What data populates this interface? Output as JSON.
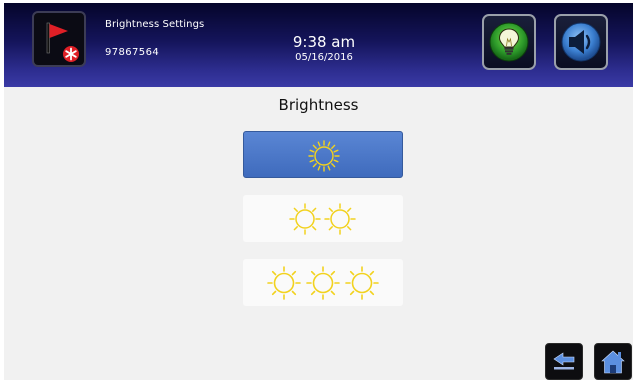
{
  "header": {
    "screen_title": "Brightness Settings",
    "device_id": "97867564",
    "time": "9:38 am",
    "date": "05/16/2016",
    "alarm_icon": "red-flag-alarm-icon",
    "light_icon": "lightbulb-icon",
    "sound_icon": "speaker-icon"
  },
  "main": {
    "title": "Brightness",
    "levels": [
      {
        "suns": 1,
        "selected": true
      },
      {
        "suns": 2,
        "selected": false
      },
      {
        "suns": 3,
        "selected": false
      }
    ]
  },
  "footer": {
    "back_icon": "back-arrow-icon",
    "home_icon": "home-icon"
  },
  "colors": {
    "header_dark": "#05052a",
    "header_light": "#3a3aa6",
    "selected_level": "#4a76c6",
    "sun_yellow": "#f2d21e"
  }
}
